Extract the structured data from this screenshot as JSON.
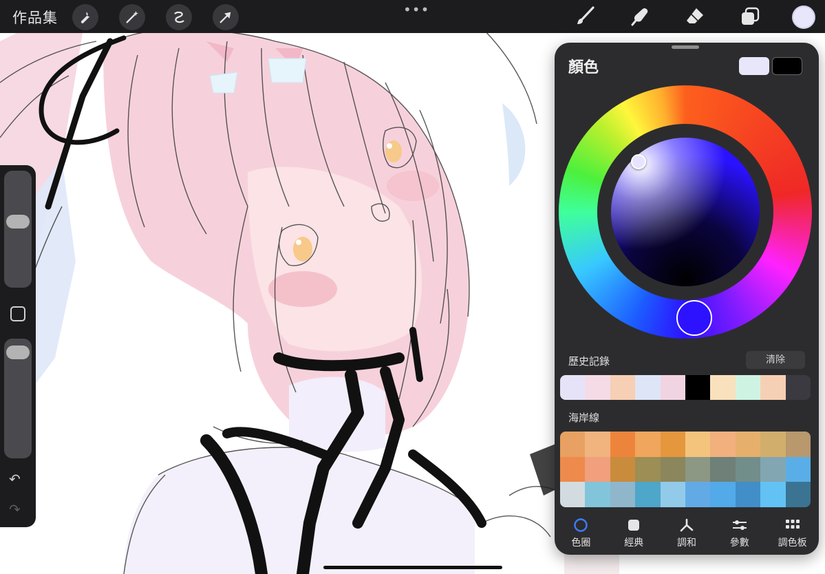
{
  "topbar": {
    "gallery_label": "作品集",
    "more_label": "•••",
    "tools_left": [
      "wrench-icon",
      "magic-wand-icon",
      "selection-icon",
      "transform-arrow-icon"
    ],
    "tools_right": [
      "brush-icon",
      "smudge-icon",
      "eraser-icon",
      "layers-icon"
    ],
    "current_color": "#e8e6fb"
  },
  "sidebar": {
    "brush_size_level": 0.58,
    "opacity_level": 0.04
  },
  "color_panel": {
    "title": "顏色",
    "primary_color": "#e8e6fb",
    "secondary_color": "#000000",
    "history": {
      "label": "歷史記錄",
      "clear_label": "清除",
      "colors": [
        "#e6e3f8",
        "#f4dbe6",
        "#f6cfb4",
        "#dde5f6",
        "#f1d4e2",
        "#000000",
        "#f9e1bd",
        "#cff3e3",
        "#f6d0b4",
        "#3b3a40"
      ]
    },
    "palette": {
      "label": "海岸線",
      "colors": [
        "#e8a162",
        "#f1b47e",
        "#ec843c",
        "#f0a65c",
        "#e5973e",
        "#f4c47c",
        "#f1b07e",
        "#e6b06c",
        "#d2ae6c",
        "#b8986c",
        "#ee8a4c",
        "#f19f7c",
        "#c98c3c",
        "#9c8e54",
        "#8c865c",
        "#8c9884",
        "#6e8078",
        "#728e8a",
        "#82a6b2",
        "#5aaee8",
        "#d2dce0",
        "#82c5da",
        "#90b6cc",
        "#4ea6ca",
        "#92caea",
        "#62aae6",
        "#52aae8",
        "#418ec8",
        "#62c2f4",
        "#3a7492"
      ]
    },
    "tabs": [
      {
        "label": "色圈",
        "icon": "disc-icon",
        "active": true
      },
      {
        "label": "經典",
        "icon": "classic-square-icon",
        "active": false
      },
      {
        "label": "調和",
        "icon": "harmony-icon",
        "active": false
      },
      {
        "label": "參數",
        "icon": "sliders-icon",
        "active": false
      },
      {
        "label": "調色板",
        "icon": "palette-grid-icon",
        "active": false
      }
    ]
  }
}
